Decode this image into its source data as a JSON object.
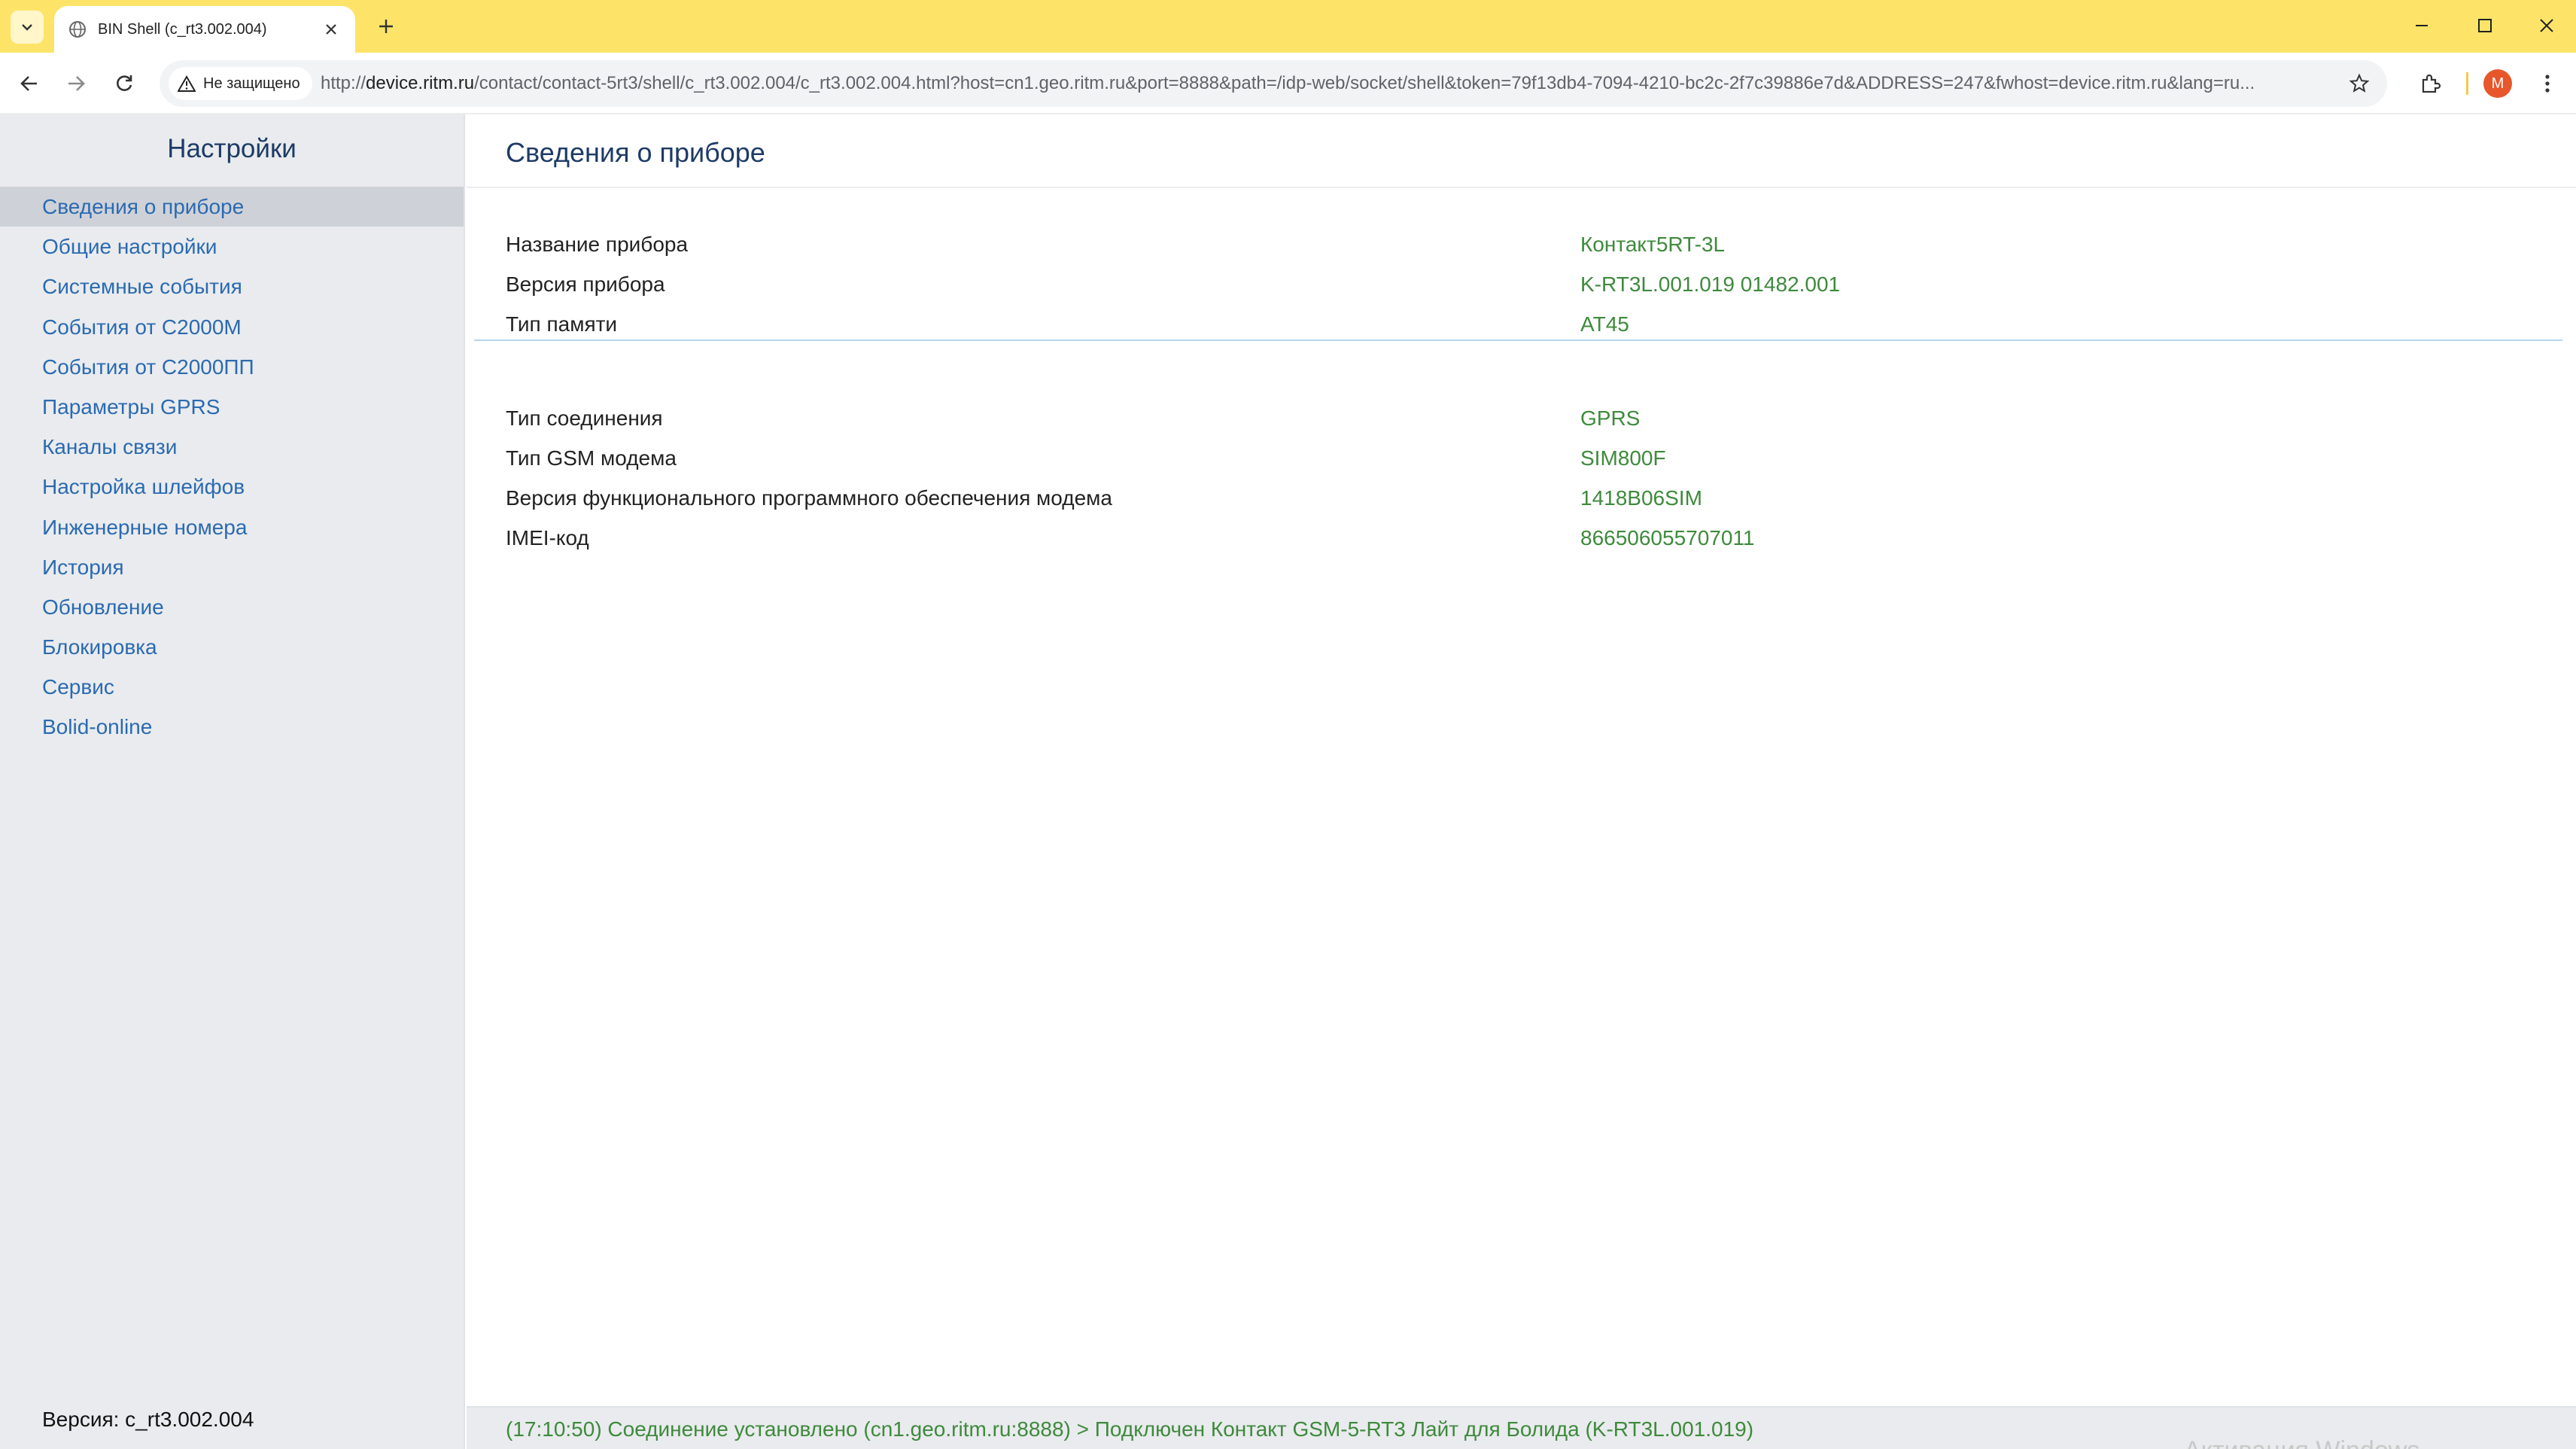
{
  "browser": {
    "tab_title": "BIN Shell (c_rt3.002.004)",
    "security_label": "Не защищено",
    "url_host": "device.ritm.ru",
    "url_prefix": "http://",
    "url_rest": "/contact/contact-5rt3/shell/c_rt3.002.004/c_rt3.002.004.html?host=cn1.geo.ritm.ru&port=8888&path=/idp-web/socket/shell&token=79f13db4-7094-4210-bc2c-2f7c39886e7d&ADDRESS=247&fwhost=device.ritm.ru&lang=ru...",
    "avatar_letter": "M",
    "icons": [
      "tab-search-icon",
      "globe-icon",
      "close-icon",
      "plus-icon",
      "minimize-icon",
      "maximize-icon",
      "window-close-icon",
      "back-arrow-icon",
      "forward-arrow-icon",
      "reload-icon",
      "warning-icon",
      "star-icon",
      "extensions-icon",
      "kebab-menu-icon"
    ]
  },
  "sidebar": {
    "title": "Настройки",
    "items": [
      {
        "label": "Сведения о приборе",
        "active": true
      },
      {
        "label": "Общие настройки"
      },
      {
        "label": "Системные события"
      },
      {
        "label": "События от С2000М"
      },
      {
        "label": "События от С2000ПП"
      },
      {
        "label": "Параметры GPRS"
      },
      {
        "label": "Каналы связи"
      },
      {
        "label": "Настройка шлейфов"
      },
      {
        "label": "Инженерные номера"
      },
      {
        "label": "История"
      },
      {
        "label": "Обновление"
      },
      {
        "label": "Блокировка"
      },
      {
        "label": "Сервис"
      },
      {
        "label": "Bolid-online"
      }
    ],
    "version": "Версия: c_rt3.002.004"
  },
  "main": {
    "title": "Сведения о приборе",
    "device_info": [
      {
        "key": "Название прибора",
        "value": "Контакт5RT-3L"
      },
      {
        "key": "Версия прибора",
        "value": "K-RT3L.001.019 01482.001"
      },
      {
        "key": "Тип памяти",
        "value": "AT45"
      }
    ],
    "modem_info": [
      {
        "key": "Тип соединения",
        "value": "GPRS"
      },
      {
        "key": "Тип GSM модема",
        "value": "SIM800F"
      },
      {
        "key": "Версия функционального программного обеспечения модема",
        "value": "1418B06SIM"
      },
      {
        "key": "IMEI-код",
        "value": "866506055707011"
      }
    ]
  },
  "status": {
    "text": "(17:10:50) Соединение установлено (cn1.geo.ritm.ru:8888) > Подключен Контакт GSM-5-RT3 Лайт для Болида (K-RT3L.001.019)",
    "watermark": "Активация Windows"
  },
  "colors": {
    "tabbar": "#fde469",
    "link": "#2b6ab0",
    "value_green": "#3e8a3c",
    "title_navy": "#1d3b66",
    "divider_blue": "#b9d3ee"
  }
}
